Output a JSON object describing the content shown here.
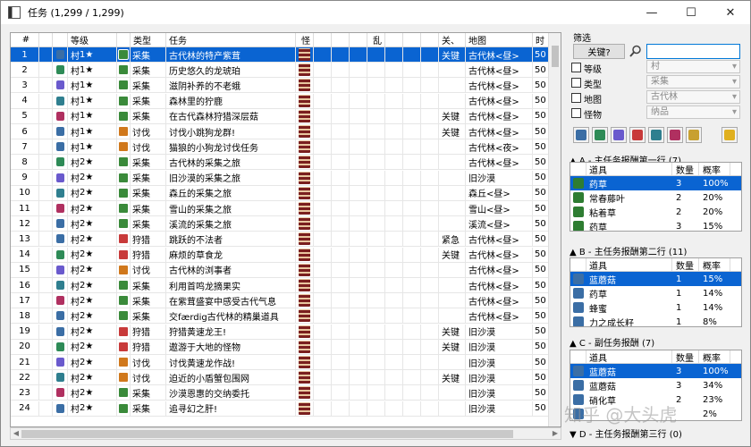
{
  "window": {
    "title": "任务 (1,299 / 1,299)",
    "minimize": "—",
    "maximize": "☐",
    "close": "✕"
  },
  "grid": {
    "headers": [
      "#",
      "",
      "",
      "等级",
      "",
      "类型",
      "任务",
      "怪",
      "",
      "",
      "",
      "乱",
      "",
      "",
      "",
      "关、",
      "地图",
      "时",
      ""
    ],
    "rows": [
      {
        "n": "1",
        "rank": "1★",
        "type": "采集",
        "name": "古代林的特产紫茸",
        "key": "关键",
        "map": "古代林<昼>",
        "time": "50",
        "sel": true
      },
      {
        "n": "2",
        "rank": "1★",
        "type": "采集",
        "name": "历史悠久的龙琥珀",
        "key": "",
        "map": "古代林<昼>",
        "time": "50"
      },
      {
        "n": "3",
        "rank": "1★",
        "type": "采集",
        "name": "滋阴补养的不老蛾",
        "key": "",
        "map": "古代林<昼>",
        "time": "50"
      },
      {
        "n": "4",
        "rank": "1★",
        "type": "采集",
        "name": "森林里的狞鹿",
        "key": "",
        "map": "古代林<昼>",
        "time": "50"
      },
      {
        "n": "5",
        "rank": "1★",
        "type": "采集",
        "name": "在古代森林狩猎深层菇",
        "key": "关键",
        "map": "古代林<昼>",
        "time": "50"
      },
      {
        "n": "6",
        "rank": "1★",
        "type": "讨伐",
        "name": "讨伐小跳狗龙群!",
        "key": "关键",
        "map": "古代林<昼>",
        "time": "50"
      },
      {
        "n": "7",
        "rank": "1★",
        "type": "讨伐",
        "name": "猫狼的小狗龙讨伐任务",
        "key": "",
        "map": "古代林<夜>",
        "time": "50"
      },
      {
        "n": "8",
        "rank": "2★",
        "type": "采集",
        "name": "古代林的采集之旅",
        "key": "",
        "map": "古代林<昼>",
        "time": "50"
      },
      {
        "n": "9",
        "rank": "2★",
        "type": "采集",
        "name": "旧沙漠的采集之旅",
        "key": "",
        "map": "旧沙漠",
        "time": "50"
      },
      {
        "n": "10",
        "rank": "2★",
        "type": "采集",
        "name": "森丘的采集之旅",
        "key": "",
        "map": "森丘<昼>",
        "time": "50"
      },
      {
        "n": "11",
        "rank": "2★",
        "type": "采集",
        "name": "雪山的采集之旅",
        "key": "",
        "map": "雪山<昼>",
        "time": "50"
      },
      {
        "n": "12",
        "rank": "2★",
        "type": "采集",
        "name": "溪流的采集之旅",
        "key": "",
        "map": "溪流<昼>",
        "time": "50"
      },
      {
        "n": "13",
        "rank": "2★",
        "type": "狩猎",
        "name": "跳跃的不法者",
        "key": "紧急",
        "map": "古代林<昼>",
        "time": "50"
      },
      {
        "n": "14",
        "rank": "2★",
        "type": "狩猎",
        "name": "麻烦的草食龙",
        "key": "关键",
        "map": "古代林<昼>",
        "time": "50"
      },
      {
        "n": "15",
        "rank": "2★",
        "type": "讨伐",
        "name": "古代林的浏事者",
        "key": "",
        "map": "古代林<昼>",
        "time": "50"
      },
      {
        "n": "16",
        "rank": "2★",
        "type": "采集",
        "name": "利用首鸣龙摘果实",
        "key": "",
        "map": "古代林<昼>",
        "time": "50"
      },
      {
        "n": "17",
        "rank": "2★",
        "type": "采集",
        "name": "在紫茸盛宴中感受古代气息",
        "key": "",
        "map": "古代林<昼>",
        "time": "50"
      },
      {
        "n": "18",
        "rank": "2★",
        "type": "采集",
        "name": "交færdig古代林的精巢道具",
        "key": "",
        "map": "古代林<昼>",
        "time": "50"
      },
      {
        "n": "19",
        "rank": "2★",
        "type": "狩猎",
        "name": "狩猎黄速龙王!",
        "key": "关键",
        "map": "旧沙漠",
        "time": "50"
      },
      {
        "n": "20",
        "rank": "2★",
        "type": "狩猎",
        "name": "遨游于大地的怪物",
        "key": "关键",
        "map": "旧沙漠",
        "time": "50"
      },
      {
        "n": "21",
        "rank": "2★",
        "type": "讨伐",
        "name": "讨伐黄速龙作战!",
        "key": "",
        "map": "旧沙漠",
        "time": "50"
      },
      {
        "n": "22",
        "rank": "2★",
        "type": "讨伐",
        "name": "迫近的小盾蟹包围网",
        "key": "关键",
        "map": "旧沙漠",
        "time": "50"
      },
      {
        "n": "23",
        "rank": "2★",
        "type": "采集",
        "name": "沙漠恩惠的交纳委托",
        "key": "",
        "map": "旧沙漠",
        "time": "50"
      },
      {
        "n": "24",
        "rank": "2★",
        "type": "采集",
        "name": "追寻幻之肝!",
        "key": "",
        "map": "旧沙漠",
        "time": "50"
      }
    ],
    "village": "村"
  },
  "filter": {
    "title": "筛选",
    "keyword_button": "关键?",
    "search_value": "",
    "rank_label": "等级",
    "rank_value": "村",
    "type_label": "类型",
    "type_value": "采集",
    "map_label": "地图",
    "map_value": "古代林",
    "monster_label": "怪物",
    "monster_value": "纳品"
  },
  "rewards": {
    "a": {
      "title": "▲ A - 主任务报酬第一行 (7)",
      "headers": [
        "道具",
        "数量",
        "概率"
      ],
      "rows": [
        {
          "item": "药草",
          "qty": "3",
          "rate": "100%",
          "sel": true
        },
        {
          "item": "常春藤叶",
          "qty": "2",
          "rate": "20%"
        },
        {
          "item": "粘着草",
          "qty": "2",
          "rate": "20%"
        },
        {
          "item": "药草",
          "qty": "3",
          "rate": "15%"
        }
      ]
    },
    "b": {
      "title": "▲ B - 主任务报酬第二行 (11)",
      "headers": [
        "道具",
        "数量",
        "概率"
      ],
      "rows": [
        {
          "item": "蓝蘑菇",
          "qty": "1",
          "rate": "15%",
          "sel": true
        },
        {
          "item": "药草",
          "qty": "1",
          "rate": "14%"
        },
        {
          "item": "蜂蜜",
          "qty": "1",
          "rate": "14%"
        },
        {
          "item": "力之成长籽",
          "qty": "1",
          "rate": "8%"
        }
      ]
    },
    "c": {
      "title": "▲ C - 副任务报酬 (7)",
      "headers": [
        "道具",
        "数量",
        "概率"
      ],
      "rows": [
        {
          "item": "蓝蘑菇",
          "qty": "3",
          "rate": "100%",
          "sel": true
        },
        {
          "item": "蓝蘑菇",
          "qty": "3",
          "rate": "34%"
        },
        {
          "item": "硝化草",
          "qty": "2",
          "rate": "23%"
        },
        {
          "item": "",
          "qty": "",
          "rate": "2%"
        }
      ]
    },
    "d": {
      "title": "▼ D - 主任务报酬第三行 (0)"
    }
  },
  "watermark": "知乎 @大头虎"
}
